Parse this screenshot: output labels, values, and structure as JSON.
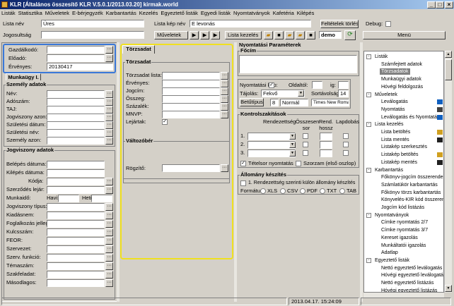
{
  "window": {
    "title": "KLR [Általános összesítő KLR V.5.0.1/2013.03.20] kirmak.world"
  },
  "menu": [
    "Listák",
    "Statisztika",
    "Műveletek",
    "E-bérjegyzék",
    "Karbantartás",
    "Kezelés",
    "Egyeztető listák",
    "Egyedi listák",
    "Nyomtatványok",
    "Kafetéria",
    "Kilépés"
  ],
  "toolbar": {
    "lista_nev_label": "Lista név",
    "lista_nev_value": "Üres",
    "lista_kep_nev_label": "Lista kép név",
    "lista_kep_nev_value": "E levonás",
    "feltetelek_torlese": "Feltételek törlése",
    "debug_label": "Debug:",
    "jogosultsag_label": "Jogosultság",
    "muveletek_label": "Műveletek",
    "lista_kezeles_label": "Lista kezelés",
    "demo_value": "demo",
    "menu_label": "Menü"
  },
  "left": {
    "gazdalkodo": "Gazdálkodó:",
    "eloado": "Előadó:",
    "ervenyes": "Érvényes:",
    "ervenyes_value": "20130417",
    "munkaugy": "Munkaügy I.",
    "szemelyi_adatok": "Személy adatok",
    "szemelyi_fields": [
      "Név:",
      "Adószám:",
      "TAJ:",
      "Jogviszony azon:",
      "Születési dátum:",
      "Születési név:",
      "Személy azon:"
    ],
    "jogviszony_adatok": "Jogviszony adatok",
    "jogviszony_fields": [
      "Belépés dátuma:",
      "Kilépés dátuma:",
      "Kódja:",
      "Szerződés lejár:",
      "Munkaidő:",
      "Jogviszony típus:",
      "Kiadásnem:",
      "Foglalkozás jelleg:",
      "Kulcsszám:",
      "FEOR:",
      "Szervezet:",
      "Szerv. funkció:",
      "Témaszám:",
      "Szakfeladat:",
      "Másodlagos:"
    ],
    "havi": "Havi:",
    "heti": "Heti:"
  },
  "center": {
    "tab": "Törzsadat",
    "torzsadat_group": "Törzsadat",
    "fields": [
      "Törzsadat lista:",
      "Érvényes:",
      "Jogcím:",
      "Összeg:",
      "Százalék:",
      "MNVP:",
      "Lejártak:"
    ],
    "valtozober": "Változóbér",
    "rogzito": "Rögzítő:"
  },
  "right": {
    "nyomtatasi_parameterek": "Nyomtatási Paraméterek",
    "focim": "Főcím",
    "nyomtatasi_kep": "Nyomtatási kép:",
    "oldaltol": "Oldaltól:",
    "ig": "ig:",
    "tajolas": "Tájolás:",
    "tajolas_value": "Fekvő",
    "sortavolsag": "Sortávolság:",
    "sortavolsag_value": "14",
    "betutipus": "Betűtípus",
    "betu_meret": "8",
    "betu_stilus": "Normál",
    "betu_nev": "Times New Roman",
    "kontrolszakitasok": "Kontrolszakítások",
    "col_rendezettseg": "Rendezettség",
    "col_osszesen": "Összesen sor",
    "col_rend_hossz": "Rend. hossz",
    "col_lapdobas": "Lapdobás",
    "rows": [
      "1.",
      "2.",
      "3."
    ],
    "tetelsor": "Tételsor nyomtatás",
    "szorzam": "Szorzam (első oszlop)",
    "allomany": "Állomány készítés",
    "rendezettseg_kulon": "1. Rendezettség szerinti külön állomány készítés",
    "formatum": "Formátum:",
    "formats": [
      "XLS",
      "CSV",
      "PDF",
      "TXT",
      "TAB"
    ]
  },
  "tree": {
    "items": [
      {
        "t": "Listák",
        "l": 0,
        "exp": "-"
      },
      {
        "t": "Számfejtett adatok",
        "l": 1
      },
      {
        "t": "Törzsadatok",
        "l": 1,
        "sel": true
      },
      {
        "t": "Munkaügyi adatok",
        "l": 1
      },
      {
        "t": "Hóvégi feldolgozás",
        "l": 1
      },
      {
        "t": "Műveletek",
        "l": 0,
        "exp": "-"
      },
      {
        "t": "Leválogatás",
        "l": 1
      },
      {
        "t": "Nyomtatás",
        "l": 1
      },
      {
        "t": "Leválogatás és Nyomtatás",
        "l": 1
      },
      {
        "t": "Lista kezelés",
        "l": 0,
        "exp": "-"
      },
      {
        "t": "Lista betöltés",
        "l": 1
      },
      {
        "t": "Lista mentés",
        "l": 1
      },
      {
        "t": "Listakép szerkesztés",
        "l": 1
      },
      {
        "t": "Listakép betöltés",
        "l": 1
      },
      {
        "t": "Listakép mentés",
        "l": 1
      },
      {
        "t": "Karbantartás",
        "l": 0,
        "exp": "-"
      },
      {
        "t": "Főkönyv-jogcím összerendelés",
        "l": 1
      },
      {
        "t": "Számlatükör karbantartás",
        "l": 1
      },
      {
        "t": "Főkönyv törzs karbantartás",
        "l": 1
      },
      {
        "t": "Könyvelés-KIR kód összerendelés",
        "l": 1
      },
      {
        "t": "Jogcím kód listázás",
        "l": 1
      },
      {
        "t": "Nyomtatványok",
        "l": 0,
        "exp": "-"
      },
      {
        "t": "Címke nyomtatás 2/7",
        "l": 1
      },
      {
        "t": "Címke nyomtatás 3/7",
        "l": 1
      },
      {
        "t": "Kereset igazolás",
        "l": 1
      },
      {
        "t": "Munkáltatói igazolás",
        "l": 1
      },
      {
        "t": "Adatlap",
        "l": 1
      },
      {
        "t": "Egyeztető listák",
        "l": 0,
        "exp": "-"
      },
      {
        "t": "Nettó egyeztető leválogatás",
        "l": 1
      },
      {
        "t": "Hóvégi egyeztető leválogatás",
        "l": 1
      },
      {
        "t": "Nettó egyeztető listázás",
        "l": 1
      },
      {
        "t": "Hóvégi egyeztető listázás",
        "l": 1
      }
    ]
  },
  "status": {
    "datetime": "2013.04.17. 15:24:09"
  }
}
